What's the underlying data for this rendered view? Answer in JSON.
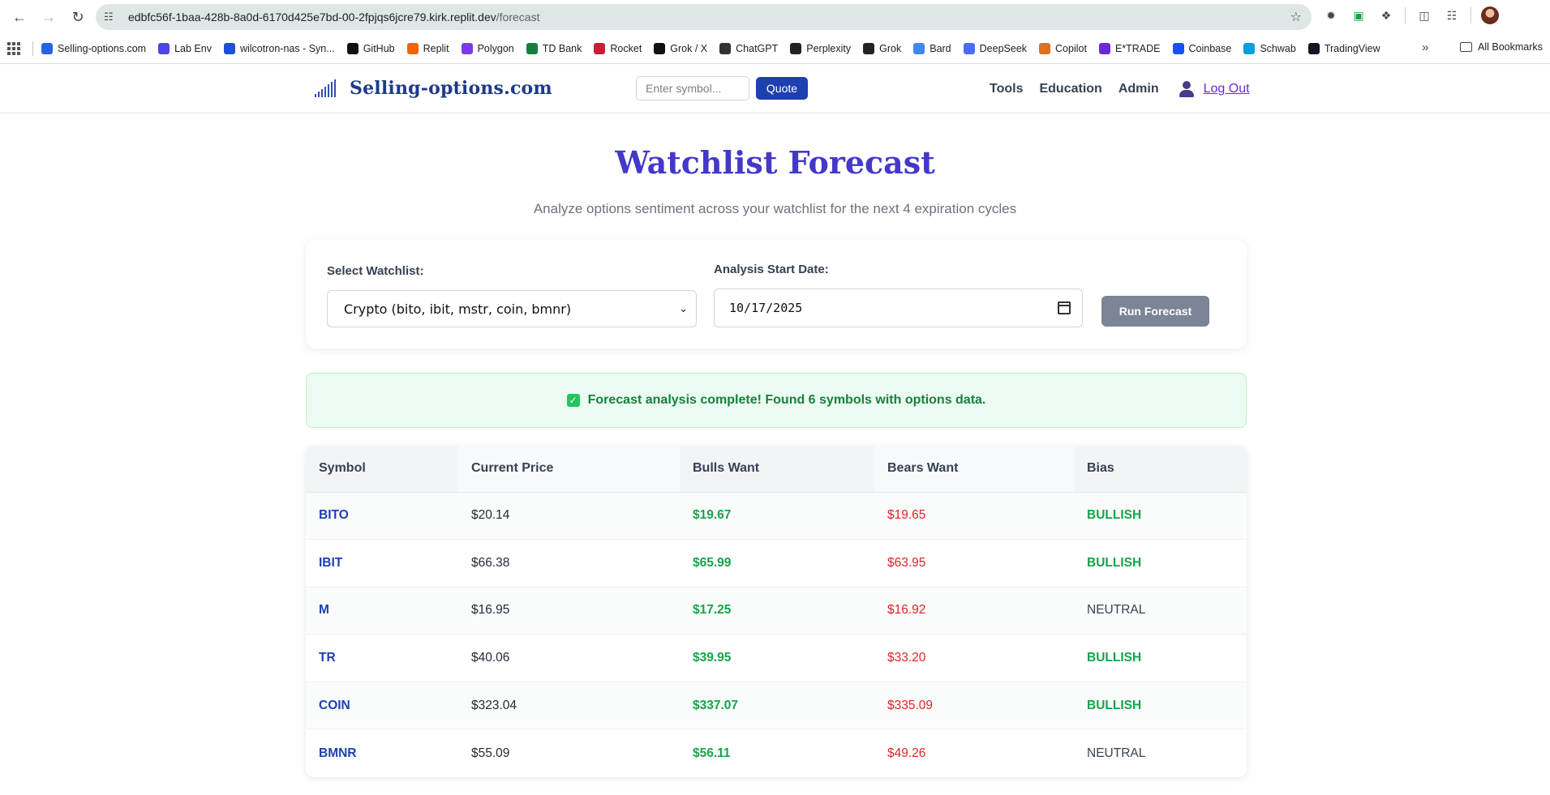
{
  "browser": {
    "url_host": "edbfc56f-1baa-428b-8a0d-6170d425e7bd-00-2fpjqs6jcre79.kirk.replit.dev",
    "url_path": "/forecast",
    "bookmarks": [
      {
        "label": "Selling-options.com",
        "icon": "so-favicon",
        "color": "#2563eb"
      },
      {
        "label": "Lab Env",
        "icon": "chart-favicon",
        "color": "#4f46e5"
      },
      {
        "label": "wilcotron-nas - Syn...",
        "icon": "dsm-favicon",
        "color": "#1d4ed8"
      },
      {
        "label": "GitHub",
        "icon": "github-icon",
        "color": "#111111"
      },
      {
        "label": "Replit",
        "icon": "replit-icon",
        "color": "#f26207"
      },
      {
        "label": "Polygon",
        "icon": "polygon-icon",
        "color": "#7c3aed"
      },
      {
        "label": "TD Bank",
        "icon": "td-icon",
        "color": "#15803d"
      },
      {
        "label": "Rocket",
        "icon": "rocket-icon",
        "color": "#c81e3a"
      },
      {
        "label": "Grok / X",
        "icon": "x-icon",
        "color": "#111111"
      },
      {
        "label": "ChatGPT",
        "icon": "chatgpt-icon",
        "color": "#333333"
      },
      {
        "label": "Perplexity",
        "icon": "perplexity-icon",
        "color": "#222222"
      },
      {
        "label": "Grok",
        "icon": "grok-icon",
        "color": "#222222"
      },
      {
        "label": "Bard",
        "icon": "bard-icon",
        "color": "#4285f4"
      },
      {
        "label": "DeepSeek",
        "icon": "deepseek-icon",
        "color": "#4d6bfe"
      },
      {
        "label": "Copilot",
        "icon": "copilot-icon",
        "color": "#e0701e"
      },
      {
        "label": "E*TRADE",
        "icon": "etrade-icon",
        "color": "#6d28d9"
      },
      {
        "label": "Coinbase",
        "icon": "coinbase-icon",
        "color": "#1652f0"
      },
      {
        "label": "Schwab",
        "icon": "schwab-icon",
        "color": "#00a0df"
      },
      {
        "label": "TradingView",
        "icon": "tradingview-icon",
        "color": "#131722"
      }
    ],
    "all_bookmarks_label": "All Bookmarks"
  },
  "site": {
    "logo_text": "Selling-options.com",
    "search_placeholder": "Enter symbol...",
    "quote_label": "Quote",
    "nav": {
      "tools": "Tools",
      "education": "Education",
      "admin": "Admin",
      "logout": "Log Out"
    }
  },
  "page": {
    "title": "Watchlist Forecast",
    "subtitle": "Analyze options sentiment across your watchlist for the next 4 expiration cycles"
  },
  "form": {
    "watchlist_label": "Select Watchlist:",
    "watchlist_value": "Crypto (bito, ibit, mstr, coin, bmnr)",
    "date_label": "Analysis Start Date:",
    "date_value": "10/17/2025",
    "run_label": "Run Forecast"
  },
  "alert": {
    "message": "Forecast analysis complete! Found 6 symbols with options data."
  },
  "table": {
    "headers": [
      "Symbol",
      "Current Price",
      "Bulls Want",
      "Bears Want",
      "Bias"
    ],
    "rows": [
      {
        "symbol": "BITO",
        "price": "$20.14",
        "bulls": "$19.67",
        "bears": "$19.65",
        "bias": "BULLISH"
      },
      {
        "symbol": "IBIT",
        "price": "$66.38",
        "bulls": "$65.99",
        "bears": "$63.95",
        "bias": "BULLISH"
      },
      {
        "symbol": "M",
        "price": "$16.95",
        "bulls": "$17.25",
        "bears": "$16.92",
        "bias": "NEUTRAL"
      },
      {
        "symbol": "TR",
        "price": "$40.06",
        "bulls": "$39.95",
        "bears": "$33.20",
        "bias": "BULLISH"
      },
      {
        "symbol": "COIN",
        "price": "$323.04",
        "bulls": "$337.07",
        "bears": "$335.09",
        "bias": "BULLISH"
      },
      {
        "symbol": "BMNR",
        "price": "$55.09",
        "bulls": "$56.11",
        "bears": "$49.26",
        "bias": "NEUTRAL"
      }
    ]
  },
  "colors": {
    "brand": "#1e3a8a",
    "title": "#4338ca",
    "bullish": "#16a34a",
    "bearish": "#dc2626",
    "quote_button": "#1e40af",
    "run_button": "#7b8596"
  }
}
